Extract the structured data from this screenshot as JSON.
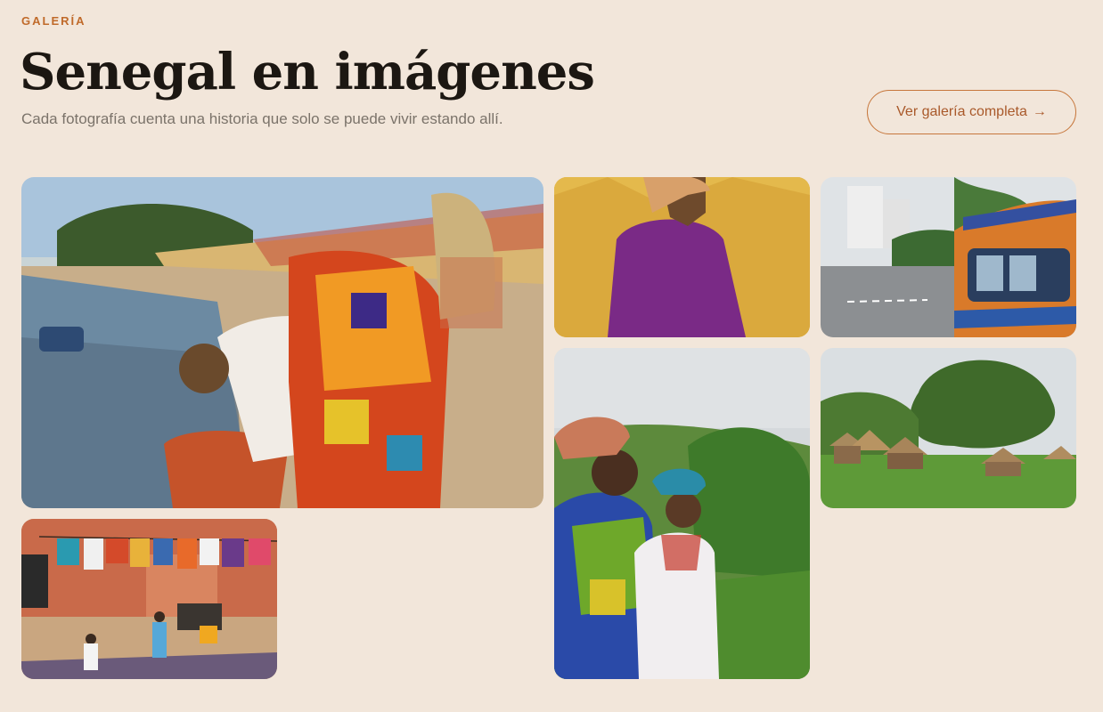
{
  "header": {
    "eyebrow": "GALERÍA",
    "title": "Senegal en imágenes",
    "subtitle": "Cada fotografía cuenta una historia que solo se puede vivir estando allí.",
    "cta_label": "Ver galería completa",
    "cta_arrow": "→"
  },
  "colors": {
    "background": "#f2e6da",
    "accent": "#c06a2a",
    "title": "#1c1712",
    "muted_text": "#7b736a"
  }
}
